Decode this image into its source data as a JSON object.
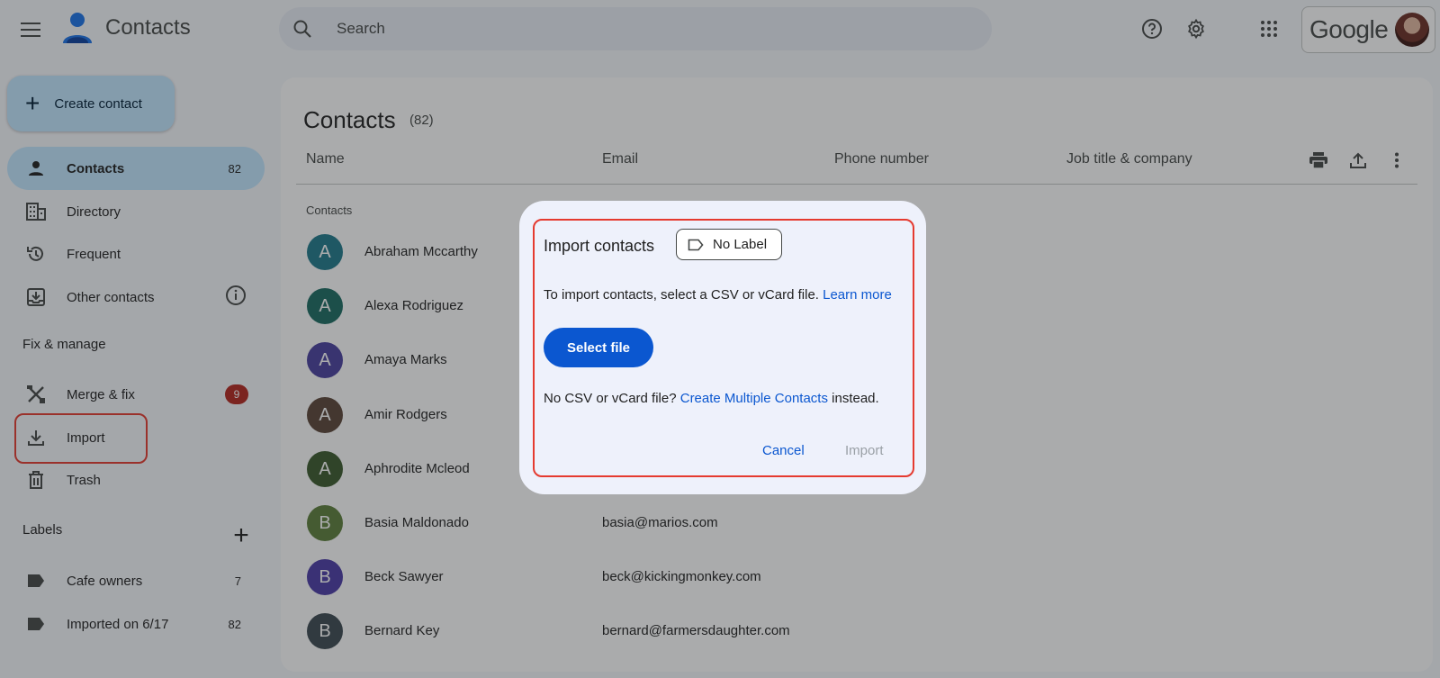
{
  "header": {
    "app_title": "Contacts",
    "search_placeholder": "Search",
    "account_brand": "Google"
  },
  "sidebar": {
    "create_label": "Create contact",
    "nav": [
      {
        "label": "Contacts",
        "count": "82",
        "icon": "person-icon",
        "active": true
      },
      {
        "label": "Directory",
        "icon": "building-icon"
      },
      {
        "label": "Frequent",
        "icon": "history-icon"
      },
      {
        "label": "Other contacts",
        "icon": "inbox-download-icon"
      }
    ],
    "fix_section": "Fix & manage",
    "fix": [
      {
        "label": "Merge & fix",
        "badge": "9",
        "icon": "merge-fix-icon"
      },
      {
        "label": "Import",
        "icon": "download-icon"
      },
      {
        "label": "Trash",
        "icon": "trash-icon"
      }
    ],
    "labels_section": "Labels",
    "labels": [
      {
        "label": "Cafe owners",
        "count": "7",
        "icon": "label-icon"
      },
      {
        "label": "Imported on 6/17",
        "count": "82",
        "icon": "label-icon"
      }
    ]
  },
  "main": {
    "title": "Contacts",
    "count": "(82)",
    "columns": [
      "Name",
      "Email",
      "Phone number",
      "Job title & company"
    ],
    "group_label": "Contacts",
    "rows": [
      {
        "initial": "A",
        "name": "Abraham Mccarthy",
        "email": "",
        "color": "#1f7a8c"
      },
      {
        "initial": "A",
        "name": "Alexa Rodriguez",
        "email": "",
        "color": "#1a6b62"
      },
      {
        "initial": "A",
        "name": "Amaya Marks",
        "email": "",
        "color": "#4a3f9f"
      },
      {
        "initial": "A",
        "name": "Amir Rodgers",
        "email": "",
        "color": "#5b4438"
      },
      {
        "initial": "A",
        "name": "Aphrodite Mcleod",
        "email": "",
        "color": "#3a5a2c"
      },
      {
        "initial": "B",
        "name": "Basia Maldonado",
        "email": "basia@marios.com",
        "color": "#5d7f3a"
      },
      {
        "initial": "B",
        "name": "Beck Sawyer",
        "email": "beck@kickingmonkey.com",
        "color": "#4b3ba6"
      },
      {
        "initial": "B",
        "name": "Bernard Key",
        "email": "bernard@farmersdaughter.com",
        "color": "#3c4a52"
      }
    ]
  },
  "dialog": {
    "title": "Import contacts",
    "label_chip": "No Label",
    "desc_prefix": "To import contacts, select a CSV or vCard file.",
    "learn_more": "Learn more",
    "select_file": "Select file",
    "alt_prefix": "No CSV or vCard file?",
    "alt_link": "Create Multiple Contacts",
    "alt_suffix": "instead.",
    "cancel": "Cancel",
    "import": "Import"
  }
}
